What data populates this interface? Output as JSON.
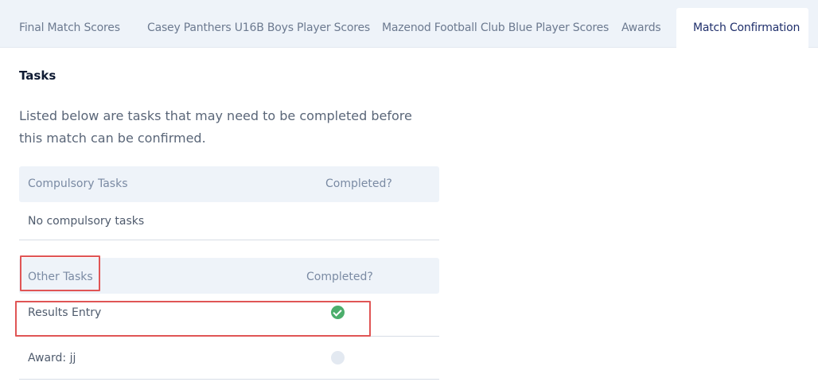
{
  "tabs": [
    {
      "label": "Final Match Scores",
      "active": false
    },
    {
      "label": "Casey Panthers U16B Boys Player Scores",
      "active": false
    },
    {
      "label": "Mazenod Football Club Blue Player Scores",
      "active": false
    },
    {
      "label": "Awards",
      "active": false
    },
    {
      "label": "Match Confirmation",
      "active": true
    }
  ],
  "tasks": {
    "heading": "Tasks",
    "intro": "Listed below are tasks that may need to be completed before this match can be confirmed.",
    "compulsory": {
      "header_label": "Compulsory Tasks",
      "completed_label": "Completed?",
      "empty_text": "No compulsory tasks"
    },
    "other": {
      "header_label": "Other Tasks",
      "completed_label": "Completed?",
      "rows": [
        {
          "label": "Results Entry",
          "completed": true
        },
        {
          "label": "Award: jj",
          "completed": false
        }
      ]
    }
  },
  "colors": {
    "accent": "#1f2f6b",
    "success": "#4cae6c",
    "highlight": "#e05555",
    "tab_bg": "#eef3f9"
  }
}
